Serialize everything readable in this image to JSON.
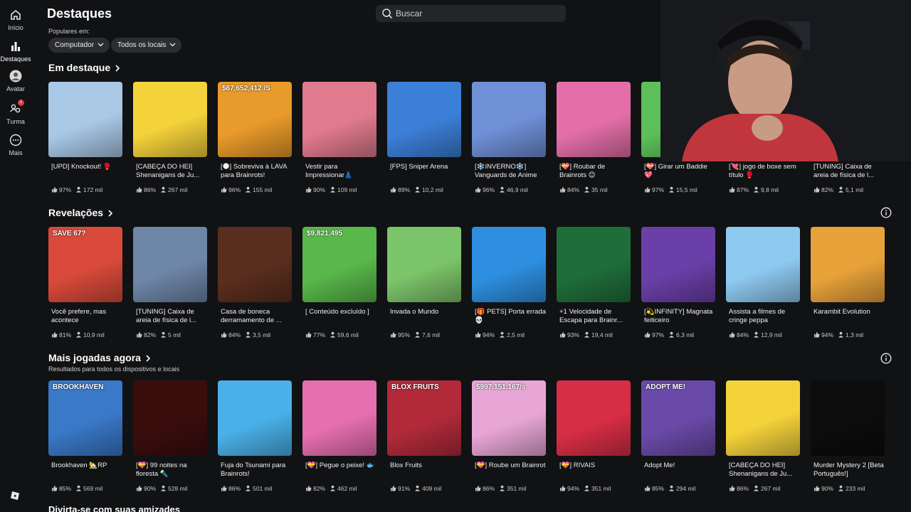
{
  "nav": {
    "items": [
      {
        "label": "Início",
        "icon": "home-icon"
      },
      {
        "label": "Destaques",
        "icon": "charts-icon"
      },
      {
        "label": "Avatar",
        "icon": "avatar-icon"
      },
      {
        "label": "Turma",
        "icon": "friends-icon",
        "badge": "1"
      },
      {
        "label": "Mais",
        "icon": "more-icon"
      }
    ]
  },
  "header": {
    "title": "Destaques",
    "search_placeholder": "Buscar",
    "popular_in": "Populares em:",
    "filters": [
      "Computador",
      "Todos os locais"
    ]
  },
  "sections": [
    {
      "title": "Em destaque",
      "subtitle": "",
      "games": [
        {
          "name": "[UPD] Knockout! 🥊",
          "rating": "97%",
          "players": "172 mil",
          "color": "#a9c8e6"
        },
        {
          "name": "[CABEÇA DO HEI] Shenanigans de Ju...",
          "rating": "86%",
          "players": "267 mil",
          "color": "#f4d23a"
        },
        {
          "name": "[🌑] Sobreviva à LAVA para Brainrots!",
          "rating": "96%",
          "players": "155 mil",
          "color": "#e89a2a",
          "overlay": "$67,652,412 /S"
        },
        {
          "name": "Vestir para Impressionar👗",
          "rating": "90%",
          "players": "109 mil",
          "color": "#e07a8e"
        },
        {
          "name": "[FPS] Sniper Arena",
          "rating": "89%",
          "players": "10,2 mil",
          "color": "#3c7fd8"
        },
        {
          "name": "[❄️INVERNO❄️] Vanguards de Anime",
          "rating": "96%",
          "players": "46,9 mil",
          "color": "#6f8fd6"
        },
        {
          "name": "[💝] Roubar de Brainrots 😊",
          "rating": "84%",
          "players": "35 mil",
          "color": "#e46fa8"
        },
        {
          "name": "[💝] Girar um Baddie 💖",
          "rating": "97%",
          "players": "15,5 mil",
          "color": "#5cbf5a"
        },
        {
          "name": "[💘] jogo de boxe sem título 🥊",
          "rating": "87%",
          "players": "9,8 mil",
          "color": "#c94b4b"
        },
        {
          "name": "[TUNING] Caixa de areia de física de l...",
          "rating": "82%",
          "players": "5,1 mil",
          "color": "#7a7f8a"
        }
      ]
    },
    {
      "title": "Revelações",
      "subtitle": "",
      "games": [
        {
          "name": "Você prefere, mas acontece",
          "rating": "81%",
          "players": "10,9 mil",
          "color": "#d94a3a",
          "overlay": "SAVE 67?"
        },
        {
          "name": "[TUNING] Caixa de areia de física de l...",
          "rating": "82%",
          "players": "5 mil",
          "color": "#6e86a8"
        },
        {
          "name": "Casa de boneca derramamento de ...",
          "rating": "84%",
          "players": "3,5 mil",
          "color": "#5a2e1e"
        },
        {
          "name": "[ Conteúdo excluído ]",
          "rating": "77%",
          "players": "59,6 mil",
          "color": "#58b84a",
          "overlay": "$9,821,495"
        },
        {
          "name": "Invada o Mundo",
          "rating": "95%",
          "players": "7,6 mil",
          "color": "#7cc46a"
        },
        {
          "name": "[🎁 PETS] Porta errada 💀",
          "rating": "94%",
          "players": "2,5 mil",
          "color": "#2e8fe0"
        },
        {
          "name": "+1 Velocidade de Escapa para Brainr...",
          "rating": "93%",
          "players": "19,4 mil",
          "color": "#1f6e3a"
        },
        {
          "name": "[💫INFINITY] Magnata feiticeiro",
          "rating": "97%",
          "players": "6,3 mil",
          "color": "#6b3fa8"
        },
        {
          "name": "Assista a filmes de cringe peppa",
          "rating": "84%",
          "players": "12,9 mil",
          "color": "#8ec9f0"
        },
        {
          "name": "Karambit Evolution",
          "rating": "94%",
          "players": "1,3 mil",
          "color": "#e8a23a"
        }
      ]
    },
    {
      "title": "Mais jogadas agora",
      "subtitle": "Resultados para todos os dispositivos e locais",
      "games": [
        {
          "name": "Brookhaven 🏡RP",
          "rating": "85%",
          "players": "569 mil",
          "color": "#3a78c8",
          "overlay": "BROOKHAVEN"
        },
        {
          "name": "[💝] 99 noites na floresta 🔦",
          "rating": "90%",
          "players": "528 mil",
          "color": "#3a0d0d"
        },
        {
          "name": "Fuja do Tsunami para Brainrots!",
          "rating": "86%",
          "players": "501 mil",
          "color": "#4ab0e8"
        },
        {
          "name": "[💝] Pegue o peixe! 🐟",
          "rating": "82%",
          "players": "462 mil",
          "color": "#e66fb0"
        },
        {
          "name": "Blox Fruits",
          "rating": "91%",
          "players": "409 mil",
          "color": "#b22a3a",
          "overlay": "BLOX FRUITS"
        },
        {
          "name": "[💝] Roube um Brainrot",
          "rating": "86%",
          "players": "351 mil",
          "color": "#e8a6d6",
          "overlay": "$997,151,167/s"
        },
        {
          "name": "[💝] RIVAIS",
          "rating": "94%",
          "players": "351 mil",
          "color": "#d82e45"
        },
        {
          "name": "Adopt Me!",
          "rating": "85%",
          "players": "294 mil",
          "color": "#6a4aa8",
          "overlay": "ADOPT ME!"
        },
        {
          "name": "[CABEÇA DO HEI] Shenanigans de Ju...",
          "rating": "86%",
          "players": "267 mil",
          "color": "#f4d23a"
        },
        {
          "name": "Murder Mystery 2 [Beta Português!]",
          "rating": "90%",
          "players": "233 mil",
          "color": "#0c0c0c"
        }
      ]
    }
  ],
  "next_section_title": "Divirta-se com suas amizades"
}
